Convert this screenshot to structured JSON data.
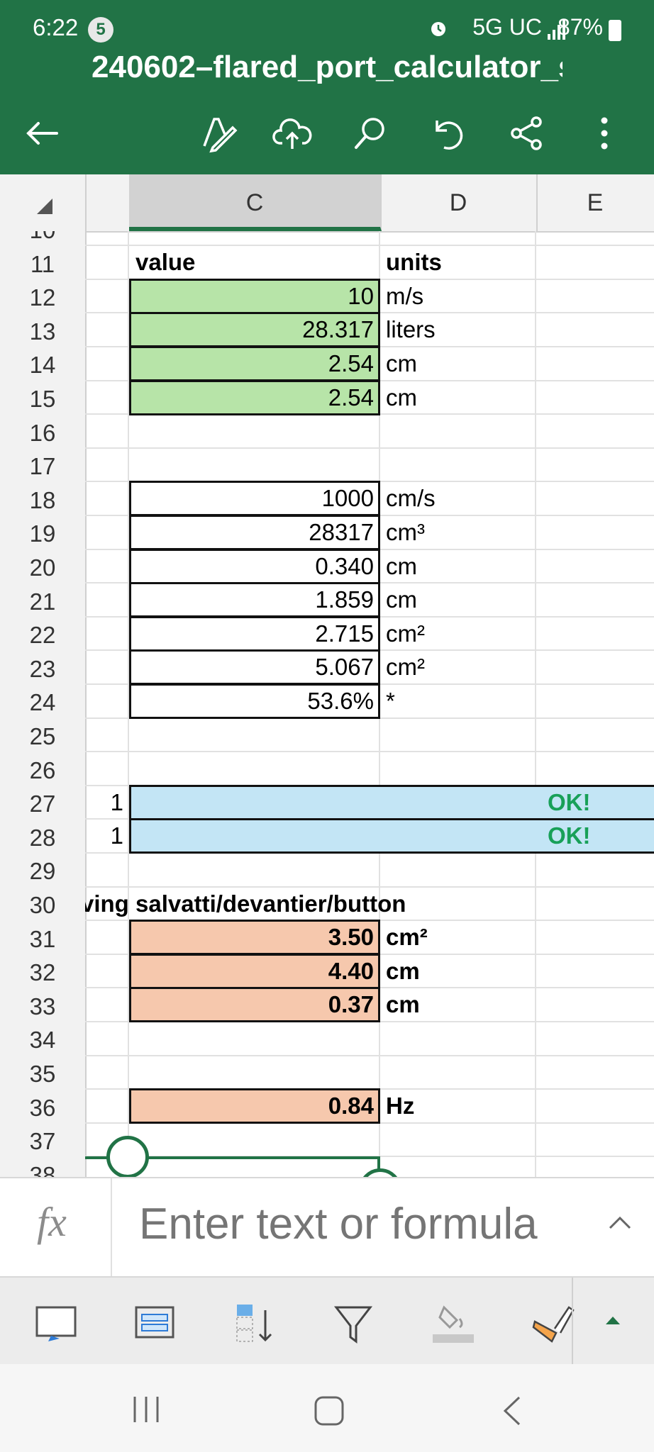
{
  "status": {
    "time": "6:22",
    "badge": "5",
    "network": "5G UC",
    "battery": "87%"
  },
  "document": {
    "title": "240602–flared_port_calculator_s"
  },
  "toolbar": {
    "icons": [
      "back-arrow-icon",
      "pen-icon",
      "cloud-upload-icon",
      "search-icon",
      "undo-icon",
      "share-icon",
      "more-icon"
    ]
  },
  "columns": [
    "C",
    "D",
    "E"
  ],
  "rows": [
    "10",
    "11",
    "12",
    "13",
    "14",
    "15",
    "16",
    "17",
    "18",
    "19",
    "20",
    "21",
    "22",
    "23",
    "24",
    "25",
    "26",
    "27",
    "28",
    "29",
    "30",
    "31",
    "32",
    "33",
    "34",
    "35",
    "36",
    "37",
    "38"
  ],
  "cells": {
    "c11": "value",
    "d11": "units",
    "c12": "10",
    "d12": "m/s",
    "c13": "28.317",
    "d13": "liters",
    "c14": "2.54",
    "d14": "cm",
    "c15": "2.54",
    "d15": "cm",
    "c18": "1000",
    "d18": "cm/s",
    "c19": "28317",
    "d19": "cm³",
    "c20": "0.340",
    "d20": "cm",
    "c21": "1.859",
    "d21": "cm",
    "c22": "2.715",
    "d22": "cm²",
    "c23": "5.067",
    "d23": "cm²",
    "c24": "53.6%",
    "d24": "*",
    "b27": "1",
    "e27": "OK!",
    "b28": "1",
    "e28": "OK!",
    "b30": "ving salvatti/devantier/button",
    "c31": "3.50",
    "d31": "cm²",
    "c32": "4.40",
    "d32": "cm",
    "c33": "0.37",
    "d33": "cm",
    "c36": "0.84",
    "d36": "Hz"
  },
  "formula": {
    "fx": "fx",
    "placeholder": "Enter text or formula"
  },
  "colors": {
    "header_green": "#217346",
    "input_green": "#b7e4a8",
    "ok_blue": "#c3e5f5",
    "ok_text": "#18a058",
    "output_orange": "#f6c8ad"
  }
}
